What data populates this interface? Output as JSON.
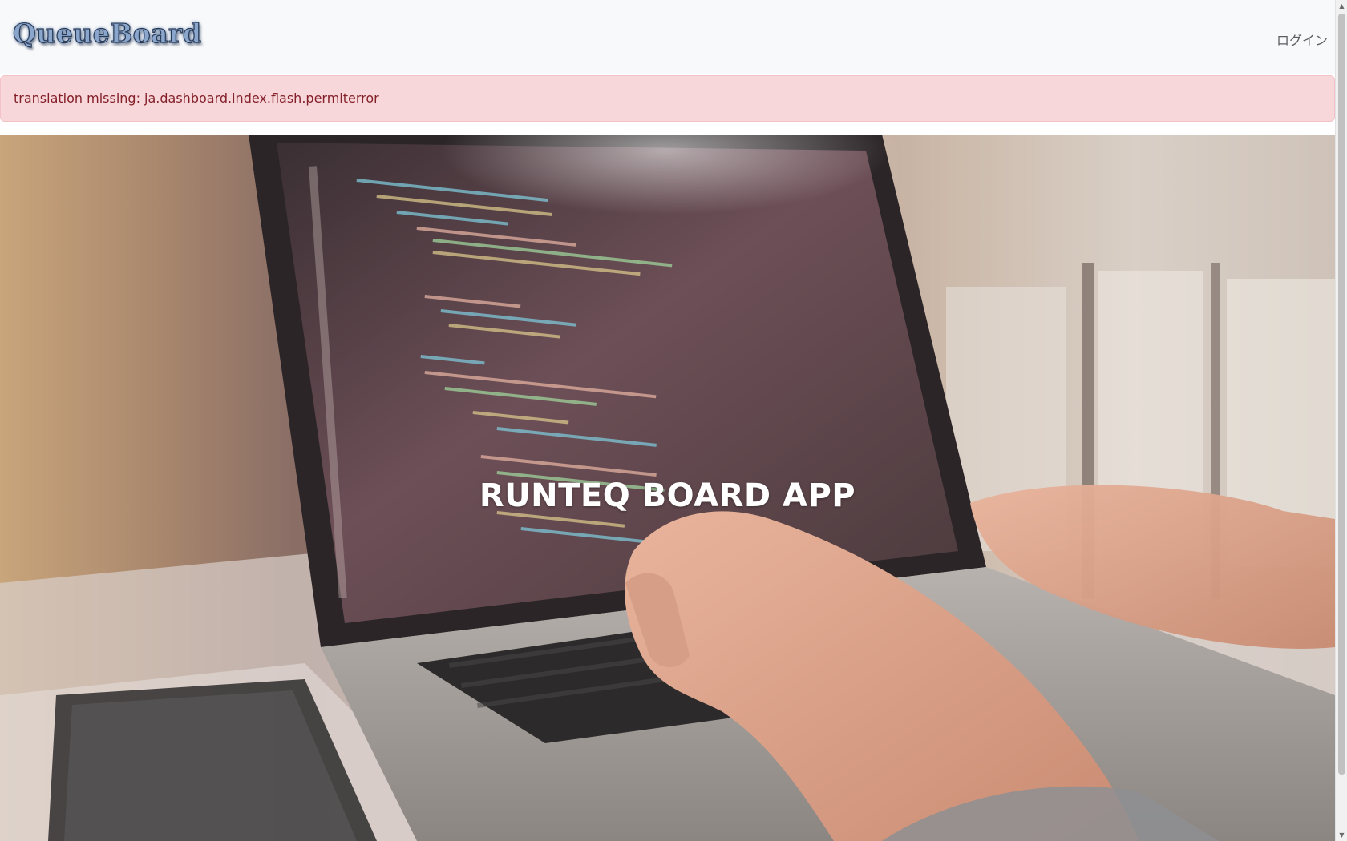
{
  "navbar": {
    "brand": "QueueBoard",
    "login_label": "ログイン"
  },
  "flash": {
    "message": "translation missing: ja.dashboard.index.flash.permiterror"
  },
  "hero": {
    "title": "RUNTEQ BOARD APP"
  },
  "icons": {
    "scroll_up": "scroll-up-arrow-icon",
    "scroll_down": "scroll-down-arrow-icon"
  },
  "colors": {
    "navbar_bg": "#f8f9fa",
    "alert_bg": "#f8d7da",
    "alert_text": "#842029",
    "hero_title": "#ffffff"
  }
}
